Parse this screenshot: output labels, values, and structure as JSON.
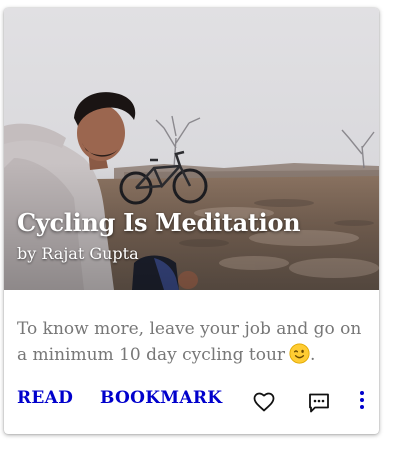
{
  "card": {
    "title": "Cycling Is Meditation",
    "author": "by Rajat Gupta",
    "description": "To know more, leave your job and go on a minimum 10 day cycling tour",
    "description_end": ".",
    "emoji_icon": "winking-face-emoji",
    "actions": {
      "read_label": "READ",
      "bookmark_label": "BOOKMARK",
      "like_icon": "heart-icon",
      "comment_icon": "comment-icon",
      "more_icon": "more-vertical-icon"
    }
  },
  "colors": {
    "action_text": "#0000cc",
    "description_text": "#777777",
    "overlay_text": "#ffffff"
  }
}
